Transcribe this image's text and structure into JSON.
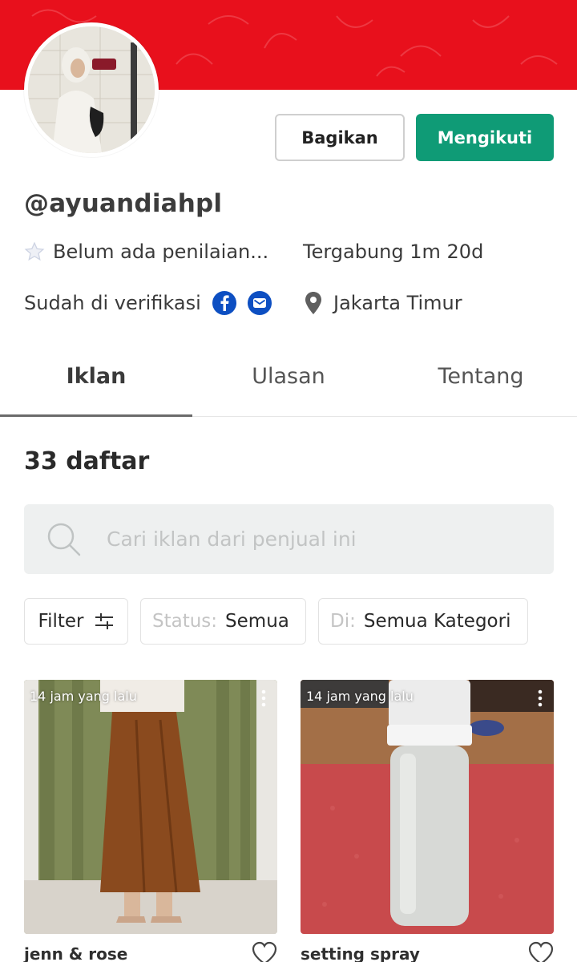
{
  "header": {
    "banner_color": "#e8101c"
  },
  "profile": {
    "username": "@ayuandiahpl",
    "rating_text": "Belum ada penilaian...",
    "joined_text": "Tergabung 1m 20d",
    "verified_text": "Sudah di verifikasi",
    "location": "Jakarta Timur",
    "icons": {
      "rating": "star-icon",
      "facebook": "facebook-icon",
      "email": "email-icon",
      "location": "location-pin-icon"
    }
  },
  "actions": {
    "share_label": "Bagikan",
    "follow_label": "Mengikuti",
    "follow_color": "#0f9b76"
  },
  "tabs": [
    {
      "label": "Iklan",
      "active": true
    },
    {
      "label": "Ulasan",
      "active": false
    },
    {
      "label": "Tentang",
      "active": false
    }
  ],
  "listings": {
    "count_text": "33 daftar",
    "search_placeholder": "Cari iklan dari penjual ini",
    "filters": {
      "filter_label": "Filter",
      "status_label": "Status:",
      "status_value": "Semua",
      "category_label": "Di:",
      "category_value": "Semua Kategori"
    },
    "items": [
      {
        "time": "14 jam yang lalu",
        "title": "jenn & rose"
      },
      {
        "time": "14 jam yang lalu",
        "title": "setting spray"
      }
    ]
  }
}
